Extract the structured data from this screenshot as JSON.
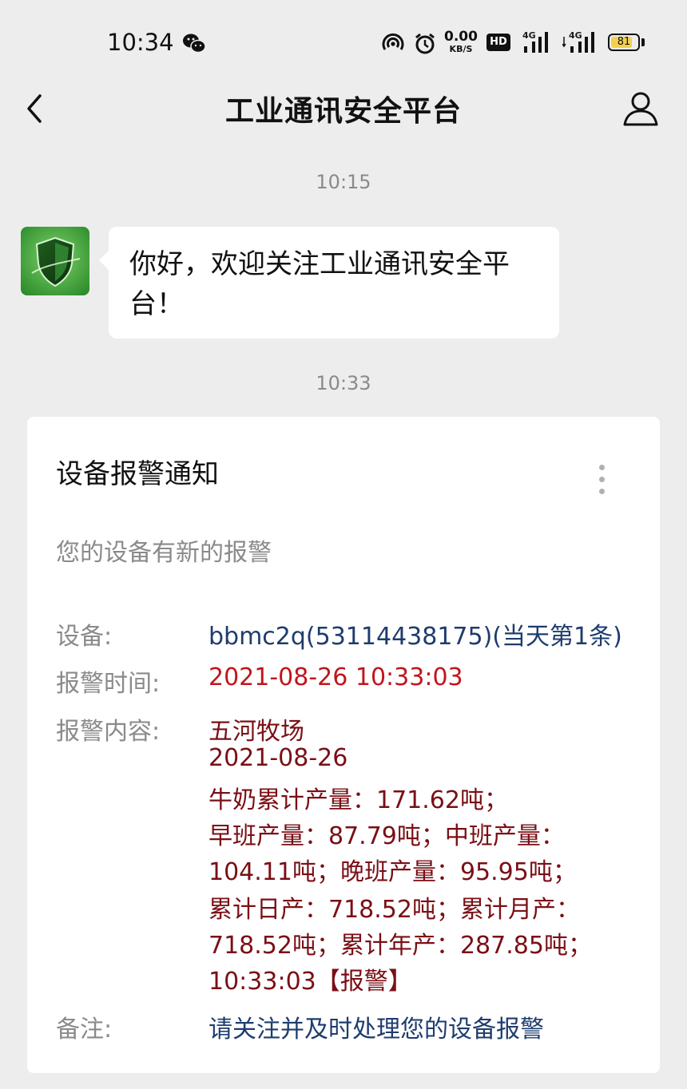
{
  "status_bar": {
    "time": "10:34",
    "net_speed_value": "0.00",
    "net_speed_unit": "KB/S",
    "hd_label": "HD",
    "signal_1_label": "4G",
    "signal_2_label": "4G",
    "battery_percent": 81,
    "battery_text": "81",
    "icons": [
      "wechat-icon",
      "hotspot-icon",
      "alarm-clock-icon",
      "signal-icon",
      "battery-icon"
    ]
  },
  "nav": {
    "title": "工业通讯安全平台",
    "back_icon": "chevron-left-icon",
    "profile_icon": "user-icon"
  },
  "messages": [
    {
      "timestamp": "10:15",
      "text_line_1": "你好，欢迎关注工业通讯安全平",
      "text_line_2": "台！"
    },
    {
      "timestamp": "10:33"
    }
  ],
  "card": {
    "title": "设备报警通知",
    "subtitle": "您的设备有新的报警",
    "device_label": "设备:",
    "device_value": "bbmc2q(53114438175)(当天第1条)",
    "alarm_time_label": "报警时间:",
    "alarm_time_value": "2021-08-26 10:33:03",
    "alarm_content_label": "报警内容:",
    "alarm_content_lines": [
      "五河牧场",
      "2021-08-26",
      "牛奶累计产量：171.62吨；",
      "早班产量：87.79吨；中班产量：",
      "104.11吨；晚班产量：95.95吨；",
      "累计日产：718.52吨；累计月产：",
      "718.52吨；累计年产：287.85吨；",
      "10:33:03【报警】"
    ],
    "remark_label": "备注:",
    "remark_value": "请关注并及时处理您的设备报警"
  },
  "colors": {
    "background": "#ededed",
    "device_value": "#1e3c6e",
    "alarm_time": "#c0161c",
    "alarm_content": "#7a0f16",
    "avatar_green": "#3c9d3c"
  }
}
